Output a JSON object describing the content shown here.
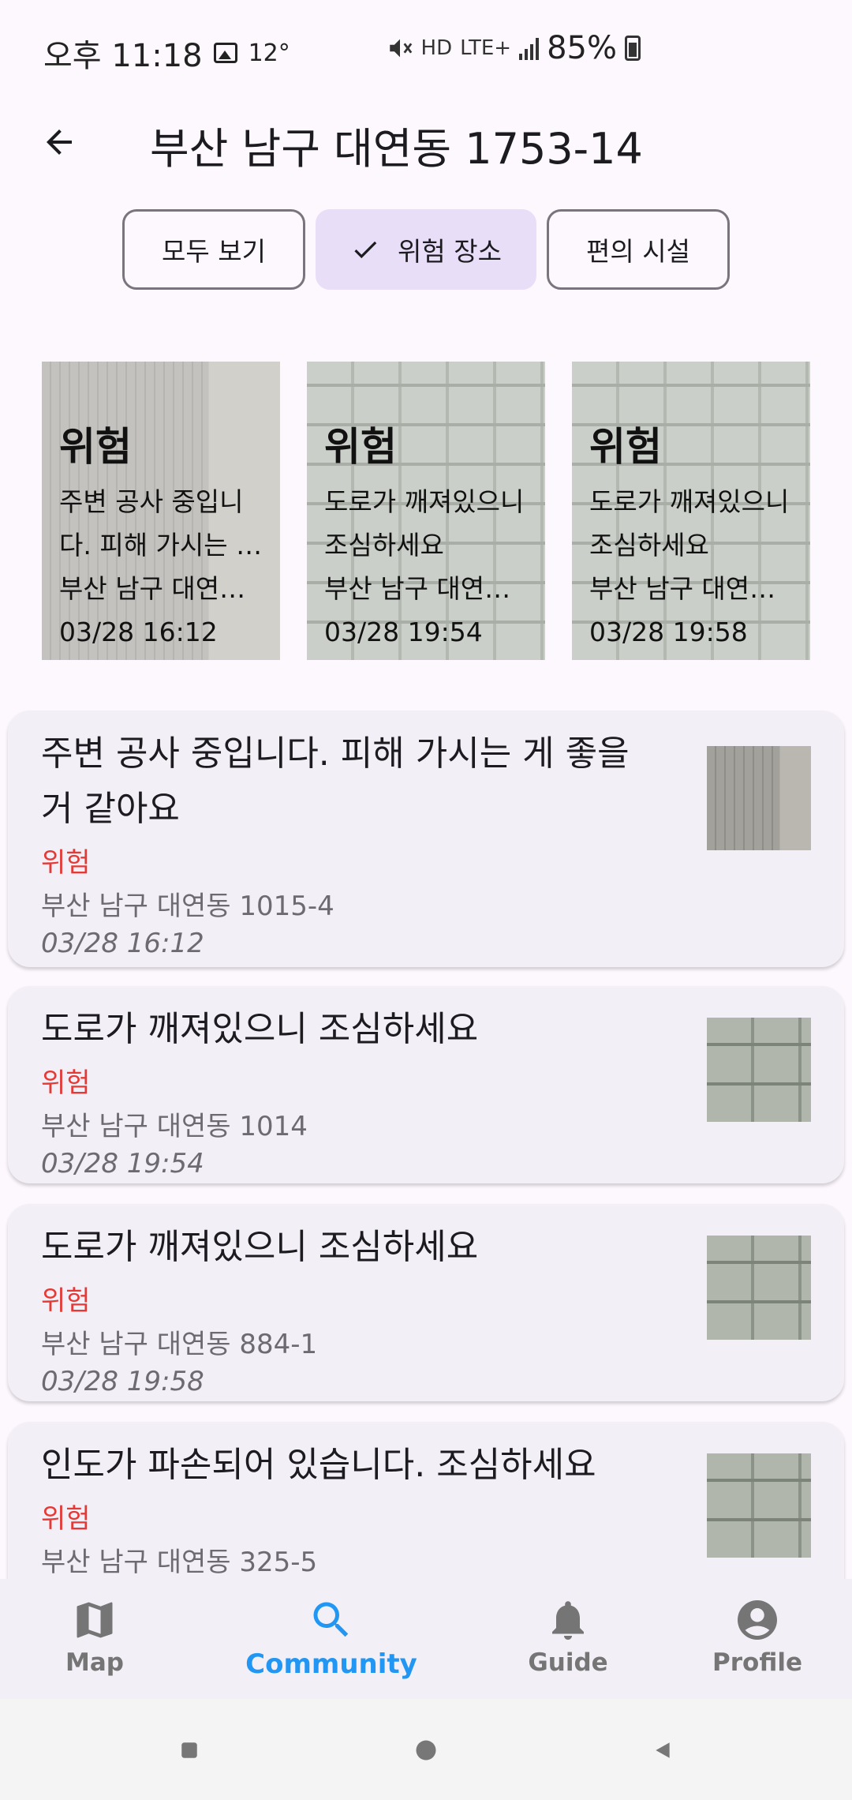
{
  "status_bar": {
    "time": "오후 11:18",
    "temperature": "12°",
    "network_hd": "HD",
    "network_lte": "LTE+",
    "battery": "85%"
  },
  "app_bar": {
    "back_icon": "arrow-back-icon",
    "title": "부산 남구 대연동 1753-14"
  },
  "filters": [
    {
      "label": "모두 보기",
      "selected": false
    },
    {
      "label": "위험 장소",
      "selected": true,
      "icon": "check-icon"
    },
    {
      "label": "편의 시설",
      "selected": false
    }
  ],
  "cards": [
    {
      "type": "위험",
      "text": "주변 공사 중입니다. 피해 가시는 게 좋을 거 같아요",
      "address": "부산 남구 대연동 1015-4",
      "time": "03/28 16:12"
    },
    {
      "type": "위험",
      "text": "도로가 깨져있으니 조심하세요",
      "address": "부산 남구 대연동 1014",
      "time": "03/28 19:54"
    },
    {
      "type": "위험",
      "text": "도로가 깨져있으니 조심하세요",
      "address": "부산 남구 대연동 884-1",
      "time": "03/28 19:58"
    }
  ],
  "list": [
    {
      "title": "주변 공사 중입니다. 피해 가시는 게 좋을 거 같아요",
      "type": "위험",
      "address": "부산 남구 대연동 1015-4",
      "time": "03/28 16:12"
    },
    {
      "title": "도로가 깨져있으니 조심하세요",
      "type": "위험",
      "address": "부산 남구 대연동 1014",
      "time": "03/28 19:54"
    },
    {
      "title": "도로가 깨져있으니 조심하세요",
      "type": "위험",
      "address": "부산 남구 대연동 884-1",
      "time": "03/28 19:58"
    },
    {
      "title": "인도가 파손되어 있습니다. 조심하세요",
      "type": "위험",
      "address": "부산 남구 대연동 325-5"
    }
  ],
  "bottom_nav": [
    {
      "label": "Map",
      "icon": "map-icon",
      "active": false
    },
    {
      "label": "Community",
      "icon": "search-icon",
      "active": true
    },
    {
      "label": "Guide",
      "icon": "bell-icon",
      "active": false
    },
    {
      "label": "Profile",
      "icon": "account-circle-icon",
      "active": false
    }
  ],
  "colors": {
    "accent": "#2196f3",
    "danger": "#e53935",
    "chip_selected": "#e8def8",
    "surface": "#f3eff6",
    "background": "#fdf8fe"
  }
}
